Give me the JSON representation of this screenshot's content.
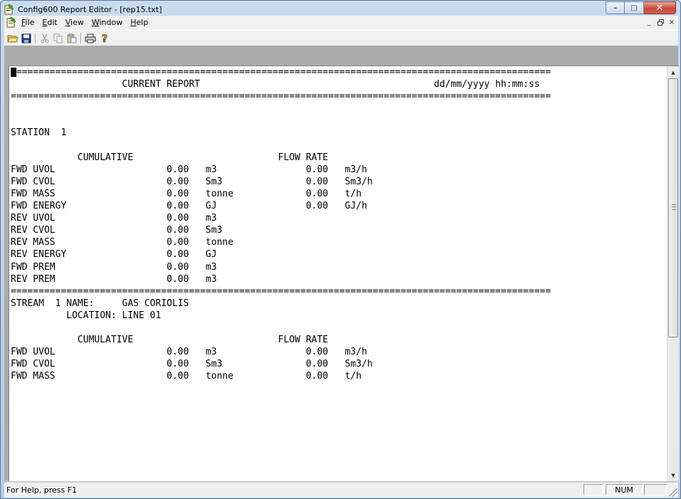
{
  "window": {
    "title": "Config600 Report Editor - [rep15.txt]",
    "minimize_glyph": "–",
    "maximize_glyph": "□",
    "close_glyph": "✕"
  },
  "menu": {
    "items": [
      {
        "label": "File",
        "accel": "F"
      },
      {
        "label": "Edit",
        "accel": "E"
      },
      {
        "label": "View",
        "accel": "V"
      },
      {
        "label": "Window",
        "accel": "W"
      },
      {
        "label": "Help",
        "accel": "H"
      }
    ],
    "mdi_minimize": "_",
    "mdi_restore": "Б",
    "mdi_close": "×"
  },
  "toolbar": {
    "buttons": [
      "open-icon",
      "save-icon",
      "cut-icon",
      "copy-icon",
      "paste-icon",
      "print-icon",
      "help-icon"
    ]
  },
  "report": {
    "lines": [
      "=================================================================================================",
      "                    CURRENT REPORT                                          dd/mm/yyyy hh:mm:ss",
      "=================================================================================================",
      "",
      "",
      "STATION  1",
      "",
      "            CUMULATIVE                          FLOW RATE",
      "FWD UVOL                    0.00   m3                0.00   m3/h",
      "FWD CVOL                    0.00   Sm3               0.00   Sm3/h",
      "FWD MASS                    0.00   tonne             0.00   t/h",
      "FWD ENERGY                  0.00   GJ                0.00   GJ/h",
      "REV UVOL                    0.00   m3",
      "REV CVOL                    0.00   Sm3",
      "REV MASS                    0.00   tonne",
      "REV ENERGY                  0.00   GJ",
      "FWD PREM                    0.00   m3",
      "REV PREM                    0.00   m3",
      "=================================================================================================",
      "STREAM  1 NAME:     GAS CORIOLIS",
      "          LOCATION: LINE 01",
      "",
      "            CUMULATIVE                          FLOW RATE",
      "FWD UVOL                    0.00   m3                0.00   m3/h",
      "FWD CVOL                    0.00   Sm3               0.00   Sm3/h",
      "FWD MASS                    0.00   tonne             0.00   t/h"
    ]
  },
  "status": {
    "help_text": "For Help, press F1",
    "num_indicator": "NUM"
  },
  "scrollbar": {
    "up_glyph": "▲",
    "down_glyph": "▼"
  }
}
